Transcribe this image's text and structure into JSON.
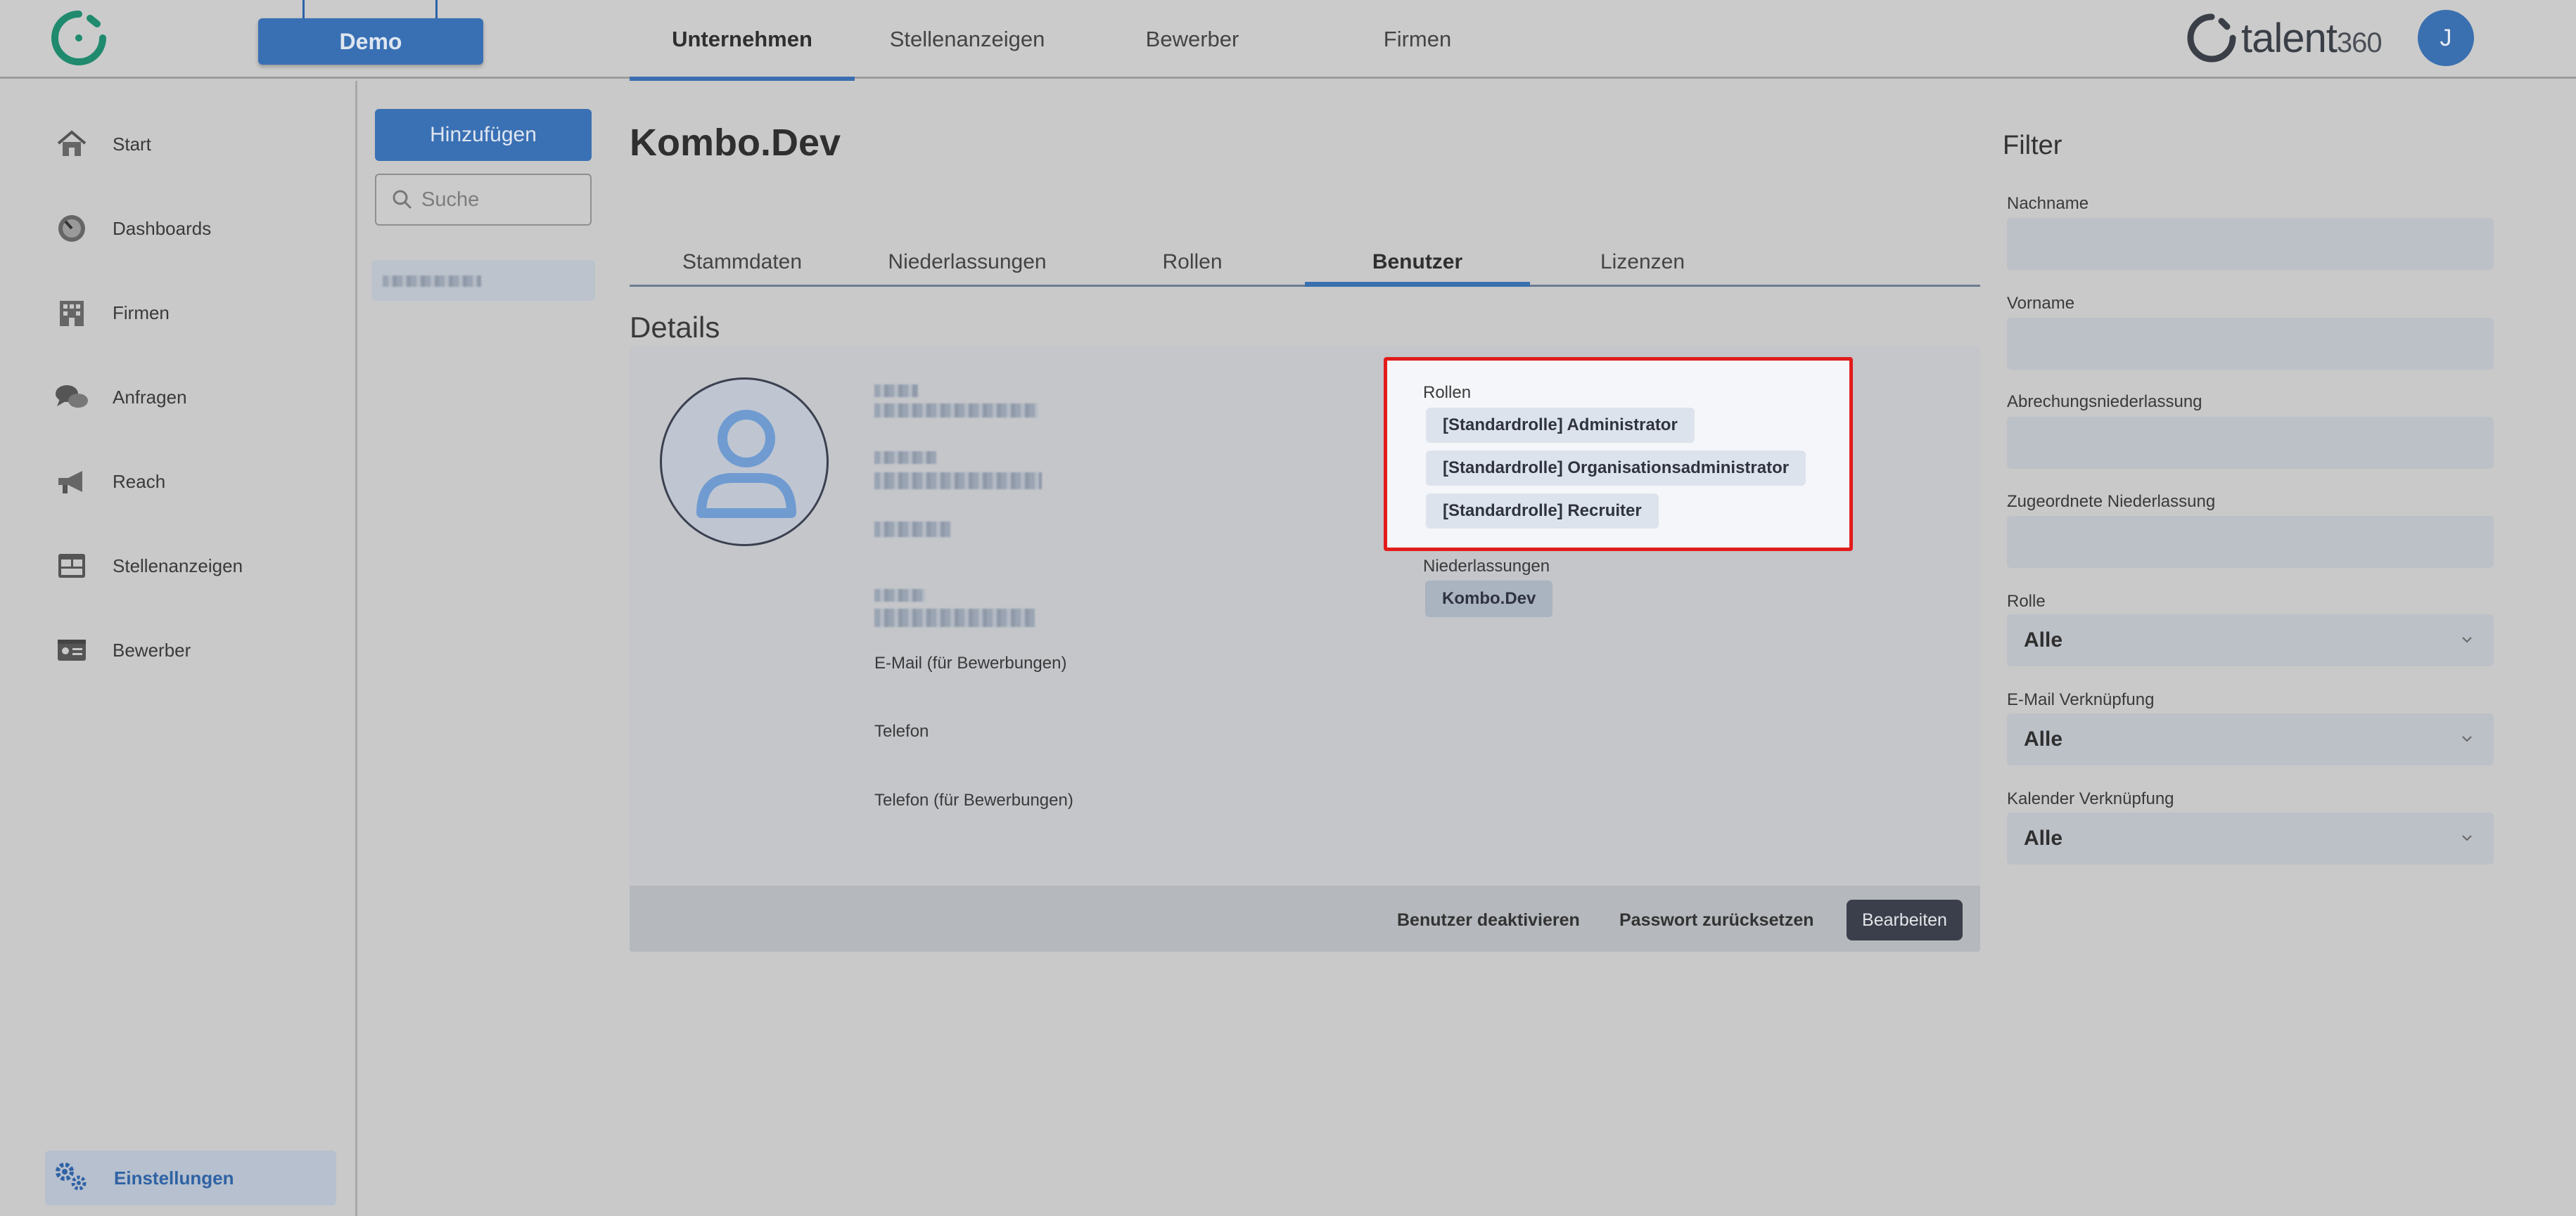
{
  "header": {
    "demo_label": "Demo",
    "tabs": [
      {
        "label": "Unternehmen",
        "active": true
      },
      {
        "label": "Stellenanzeigen",
        "active": false
      },
      {
        "label": "Bewerber",
        "active": false
      },
      {
        "label": "Firmen",
        "active": false
      }
    ],
    "brand_name": "talent",
    "brand_number": "360",
    "avatar_initial": "J",
    "accent_color": "#3a6fb0"
  },
  "sidebar": {
    "items": [
      {
        "label": "Start",
        "icon": "house-icon"
      },
      {
        "label": "Dashboards",
        "icon": "gauge-icon"
      },
      {
        "label": "Firmen",
        "icon": "building-icon"
      },
      {
        "label": "Anfragen",
        "icon": "chat-bubbles-icon"
      },
      {
        "label": "Reach",
        "icon": "megaphone-icon"
      },
      {
        "label": "Stellenanzeigen",
        "icon": "layout-grid-icon"
      },
      {
        "label": "Bewerber",
        "icon": "id-card-icon"
      }
    ],
    "settings_label": "Einstellungen"
  },
  "list_column": {
    "add_label": "Hinzufügen",
    "search_placeholder": "Suche"
  },
  "main": {
    "title": "Kombo.Dev",
    "tabs": [
      {
        "label": "Stammdaten",
        "active": false
      },
      {
        "label": "Niederlassungen",
        "active": false
      },
      {
        "label": "Rollen",
        "active": false
      },
      {
        "label": "Benutzer",
        "active": true
      },
      {
        "label": "Lizenzen",
        "active": false
      }
    ],
    "details_title": "Details",
    "fields": {
      "email_applications": "E-Mail (für Bewerbungen)",
      "phone": "Telefon",
      "phone_applications": "Telefon (für Bewerbungen)"
    },
    "roles_label": "Rollen",
    "roles": [
      "[Standardrolle] Administrator",
      "[Standardrolle] Organisationsadministrator",
      "[Standardrolle] Recruiter"
    ],
    "branches_label": "Niederlassungen",
    "branches": [
      "Kombo.Dev"
    ],
    "actions": {
      "deactivate": "Benutzer deaktivieren",
      "reset_password": "Passwort zurücksetzen",
      "edit": "Bearbeiten"
    },
    "highlight_color": "#e21b1b"
  },
  "filter": {
    "title": "Filter",
    "fields": [
      {
        "label": "Nachname",
        "type": "text",
        "value": ""
      },
      {
        "label": "Vorname",
        "type": "text",
        "value": ""
      },
      {
        "label": "Abrechungsniederlassung",
        "type": "text",
        "value": ""
      },
      {
        "label": "Zugeordnete Niederlassung",
        "type": "text",
        "value": ""
      },
      {
        "label": "Rolle",
        "type": "select",
        "value": "Alle"
      },
      {
        "label": "E-Mail Verknüpfung",
        "type": "select",
        "value": "Alle"
      },
      {
        "label": "Kalender Verknüpfung",
        "type": "select",
        "value": "Alle"
      }
    ]
  }
}
